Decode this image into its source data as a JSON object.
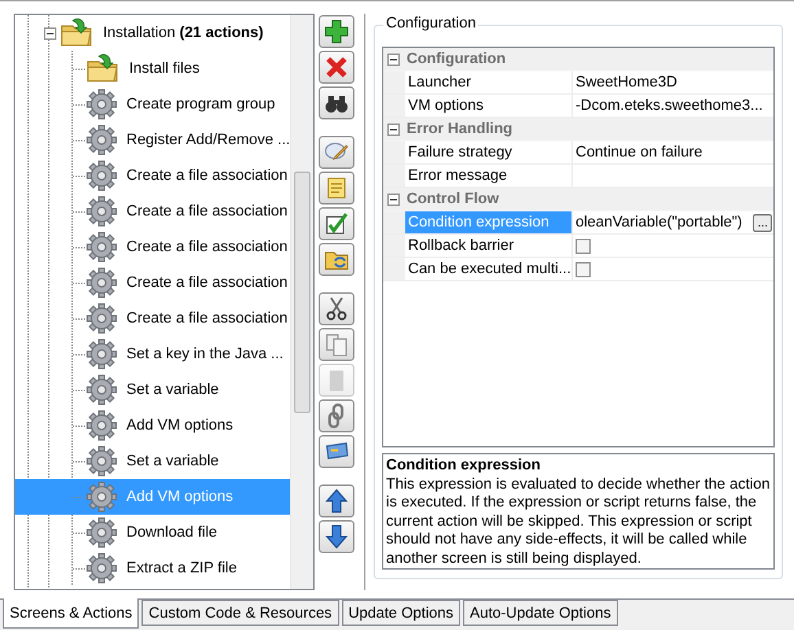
{
  "tree": {
    "label": "Installation **(21 actions)**",
    "kind": "folder",
    "expanded": true,
    "selected": false,
    "children": [
      {
        "label": "Install files",
        "kind": "folder",
        "selected": false
      },
      {
        "label": "Create program group",
        "kind": "gear",
        "selected": false
      },
      {
        "label": "Register Add/Remove ...",
        "kind": "gear",
        "selected": false
      },
      {
        "label": "Create a file association",
        "kind": "gear",
        "selected": false
      },
      {
        "label": "Create a file association",
        "kind": "gear",
        "selected": false
      },
      {
        "label": "Create a file association",
        "kind": "gear",
        "selected": false
      },
      {
        "label": "Create a file association",
        "kind": "gear",
        "selected": false
      },
      {
        "label": "Create a file association",
        "kind": "gear",
        "selected": false
      },
      {
        "label": "Set a key in the Java ...",
        "kind": "gear",
        "selected": false
      },
      {
        "label": "Set a variable",
        "kind": "gear",
        "selected": false
      },
      {
        "label": "Add VM options",
        "kind": "gear",
        "selected": false
      },
      {
        "label": "Set a variable",
        "kind": "gear",
        "selected": false
      },
      {
        "label": "Add VM options",
        "kind": "gear",
        "selected": true
      },
      {
        "label": "Download file",
        "kind": "gear",
        "selected": false
      },
      {
        "label": "Extract a ZIP file",
        "kind": "gear",
        "selected": false
      }
    ]
  },
  "toolbar": [
    [
      {
        "kind": "add",
        "disabled": false
      },
      {
        "kind": "delete",
        "disabled": false
      },
      {
        "kind": "find",
        "disabled": false
      }
    ],
    [
      {
        "kind": "comment",
        "disabled": false
      },
      {
        "kind": "note",
        "disabled": false
      },
      {
        "kind": "check",
        "disabled": false
      },
      {
        "kind": "folder",
        "disabled": false
      }
    ],
    [
      {
        "kind": "cut",
        "disabled": false
      },
      {
        "kind": "copy",
        "disabled": false
      },
      {
        "kind": "paste",
        "disabled": true
      },
      {
        "kind": "link",
        "disabled": false
      },
      {
        "kind": "card",
        "disabled": false
      }
    ],
    [
      {
        "kind": "up",
        "disabled": false
      },
      {
        "kind": "down",
        "disabled": false
      }
    ]
  ],
  "configuration": {
    "title": "Configuration",
    "categories": [
      {
        "name": "Configuration",
        "expanded": true,
        "rows": [
          {
            "name": "Launcher",
            "kind": "text",
            "value": "SweetHome3D",
            "selected": false
          },
          {
            "name": "VM options",
            "kind": "text",
            "value": "-Dcom.eteks.sweethome3...",
            "selected": false
          }
        ]
      },
      {
        "name": "Error Handling",
        "expanded": true,
        "rows": [
          {
            "name": "Failure strategy",
            "kind": "text",
            "value": "Continue on failure",
            "selected": false
          },
          {
            "name": "Error message",
            "kind": "text",
            "selected": false
          }
        ]
      },
      {
        "name": "Control Flow",
        "expanded": true,
        "rows": [
          {
            "name": "Condition expression",
            "kind": "text",
            "value": "oleanVariable(\"portable\")",
            "button": "...",
            "selected": true
          },
          {
            "name": "Rollback barrier",
            "kind": "checkbox",
            "checked": false,
            "selected": false
          },
          {
            "name": "Can be executed multi...",
            "kind": "checkbox",
            "checked": false,
            "selected": false
          }
        ]
      }
    ],
    "description": {
      "title": "Condition expression",
      "text": "This expression is evaluated to decide whether the action is executed. If the expression or script returns false, the current action will be skipped. This expression or script should not have any side-effects, it will be called while another screen is still being displayed."
    }
  },
  "tabs": [
    {
      "label": "Screens & Actions",
      "selected": true
    },
    {
      "label": "Custom Code & Resources",
      "selected": false
    },
    {
      "label": "Update Options",
      "selected": false
    },
    {
      "label": "Auto-Update Options",
      "selected": false
    }
  ]
}
